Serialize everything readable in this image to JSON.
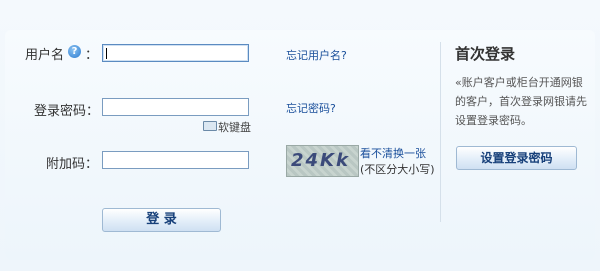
{
  "form": {
    "username_label": "用户名",
    "username_colon": "：",
    "help_icon_text": "?",
    "password_label": "登录密码：",
    "extra_code_label": "附加码：",
    "username_value": "",
    "password_value": "",
    "captcha_value": ""
  },
  "links": {
    "forgot_username": "忘记用户名?",
    "forgot_password": "忘记密码?",
    "refresh_captcha": "看不清换一张",
    "case_insensitive": "(不区分大小写)"
  },
  "keyboard": {
    "label": "软键盘",
    "icon": "keyboard-icon"
  },
  "captcha": {
    "image_text": "24Kk"
  },
  "buttons": {
    "login": "登 录",
    "set_password": "设置登录密码"
  },
  "first_login": {
    "title": "首次登录",
    "description": "«账户客户或柜台开通网银的客户，首次登录网银请先设置登录密码。"
  },
  "colors": {
    "link": "#1a4f9b",
    "input_border": "#7a9cc0",
    "button_text": "#17407a"
  }
}
